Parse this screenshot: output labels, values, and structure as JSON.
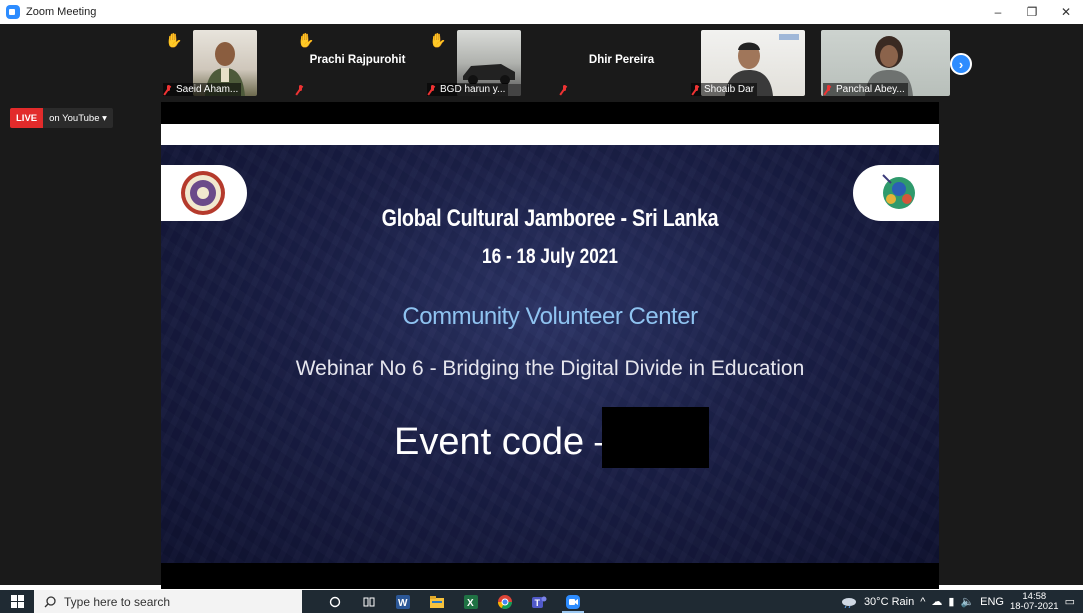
{
  "window": {
    "title": "Zoom Meeting",
    "controls": [
      "–",
      "❐",
      "✕"
    ]
  },
  "participants": [
    {
      "name": "Saeid Aham...",
      "hand_raised": true,
      "has_video": true,
      "muted": true
    },
    {
      "name": "Prachi Rajpurohit",
      "hand_raised": true,
      "has_video": false,
      "muted": true
    },
    {
      "name": "BGD harun y...",
      "hand_raised": true,
      "has_video": true,
      "muted": true
    },
    {
      "name": "Dhir Pereira",
      "hand_raised": false,
      "has_video": false,
      "muted": true
    },
    {
      "name": "Shoaib Dar",
      "hand_raised": false,
      "has_video": true,
      "muted": true
    },
    {
      "name": "Panchal Abey...",
      "hand_raised": false,
      "has_video": true,
      "muted": true
    }
  ],
  "live": {
    "badge": "LIVE",
    "destination": "on YouTube ▾"
  },
  "slide": {
    "title": "Global Cultural Jamboree - Sri Lanka",
    "dates": "16 - 18 July 2021",
    "subtitle": "Community Volunteer Center",
    "webinar": "Webinar No 6 - Bridging the Digital Divide in Education",
    "event_code_label": "Event code –"
  },
  "taskbar": {
    "search_placeholder": "Type here to search",
    "weather": "30°C  Rain",
    "language": "ENG",
    "time": "14:58",
    "date": "18-07-2021"
  },
  "colors": {
    "zoom_blue": "#2d8cff",
    "live_red": "#e22b2b",
    "slide_accent": "#8fc3f0"
  }
}
